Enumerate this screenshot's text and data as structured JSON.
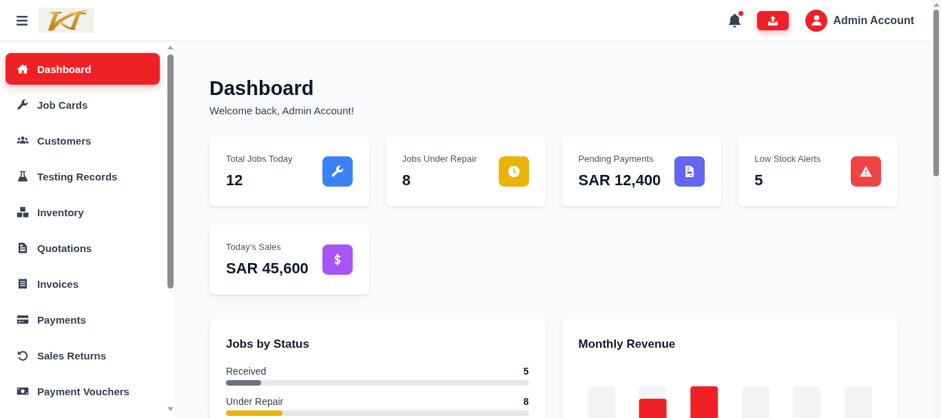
{
  "header": {
    "notifications": {
      "unread": true
    },
    "user": {
      "name": "Admin Account"
    }
  },
  "sidebar": {
    "items": [
      {
        "label": "Dashboard",
        "kind": "dashboard",
        "selected": true
      },
      {
        "label": "Job Cards",
        "kind": "jobs",
        "selected": false
      },
      {
        "label": "Customers",
        "kind": "customers",
        "selected": false
      },
      {
        "label": "Testing Records",
        "kind": "testing",
        "selected": false
      },
      {
        "label": "Inventory",
        "kind": "inventory",
        "selected": false
      },
      {
        "label": "Quotations",
        "kind": "quotations",
        "selected": false
      },
      {
        "label": "Invoices",
        "kind": "invoices",
        "selected": false
      },
      {
        "label": "Payments",
        "kind": "payments",
        "selected": false
      },
      {
        "label": "Sales Returns",
        "kind": "returns",
        "selected": false
      },
      {
        "label": "Payment Vouchers",
        "kind": "vouchers",
        "selected": false
      }
    ]
  },
  "page": {
    "title": "Dashboard",
    "subtitle": "Welcome back, Admin Account!"
  },
  "stats": [
    {
      "label": "Total Jobs Today",
      "value": "12",
      "kind": "jobs",
      "color": "#3b82f6"
    },
    {
      "label": "Jobs Under Repair",
      "value": "8",
      "kind": "repair",
      "color": "#eab308"
    },
    {
      "label": "Pending Payments",
      "value": "SAR 12,400",
      "kind": "payments",
      "color": "#6366f1"
    },
    {
      "label": "Low Stock Alerts",
      "value": "5",
      "kind": "stock",
      "color": "#ef4444"
    },
    {
      "label": "Today's Sales",
      "value": "SAR 45,600",
      "kind": "sales",
      "color": "#a855f7"
    }
  ],
  "jobs_by_status": {
    "title": "Jobs by Status",
    "rows": [
      {
        "label": "Received",
        "count": "5",
        "level": 0.116,
        "color": "#6b7280"
      },
      {
        "label": "Under Repair",
        "count": "8",
        "level": 0.186,
        "color": "#eab308"
      }
    ]
  },
  "monthly_revenue": {
    "title": "Monthly Revenue"
  }
}
